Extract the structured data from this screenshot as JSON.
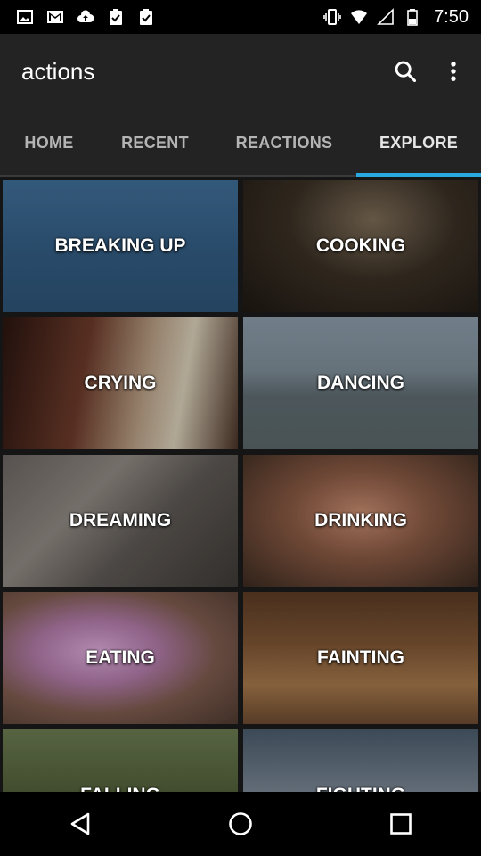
{
  "status_bar": {
    "time": "7:50",
    "left_icons": [
      "image-icon",
      "gmail-icon",
      "cloud-upload-icon",
      "clipboard-check-icon",
      "clipboard-check-icon"
    ],
    "right_icons": [
      "vibrate-icon",
      "wifi-icon",
      "cell-signal-icon",
      "battery-icon"
    ]
  },
  "app_bar": {
    "title": "actions",
    "actions": [
      "search-icon",
      "more-vert-icon"
    ]
  },
  "tabs": [
    {
      "label": "HOME",
      "active": false
    },
    {
      "label": "RECENT",
      "active": false
    },
    {
      "label": "REACTIONS",
      "active": false
    },
    {
      "label": "EXPLORE",
      "active": true
    }
  ],
  "accent_color": "#29a8e0",
  "grid": {
    "tiles": [
      {
        "label": "BREAKING UP"
      },
      {
        "label": "COOKING"
      },
      {
        "label": "CRYING"
      },
      {
        "label": "DANCING"
      },
      {
        "label": "DREAMING"
      },
      {
        "label": "DRINKING"
      },
      {
        "label": "EATING"
      },
      {
        "label": "FAINTING"
      },
      {
        "label": "FALLING"
      },
      {
        "label": "FIGHTING"
      }
    ]
  },
  "nav_bar": {
    "buttons": [
      "back-icon",
      "home-icon",
      "recents-icon"
    ]
  }
}
